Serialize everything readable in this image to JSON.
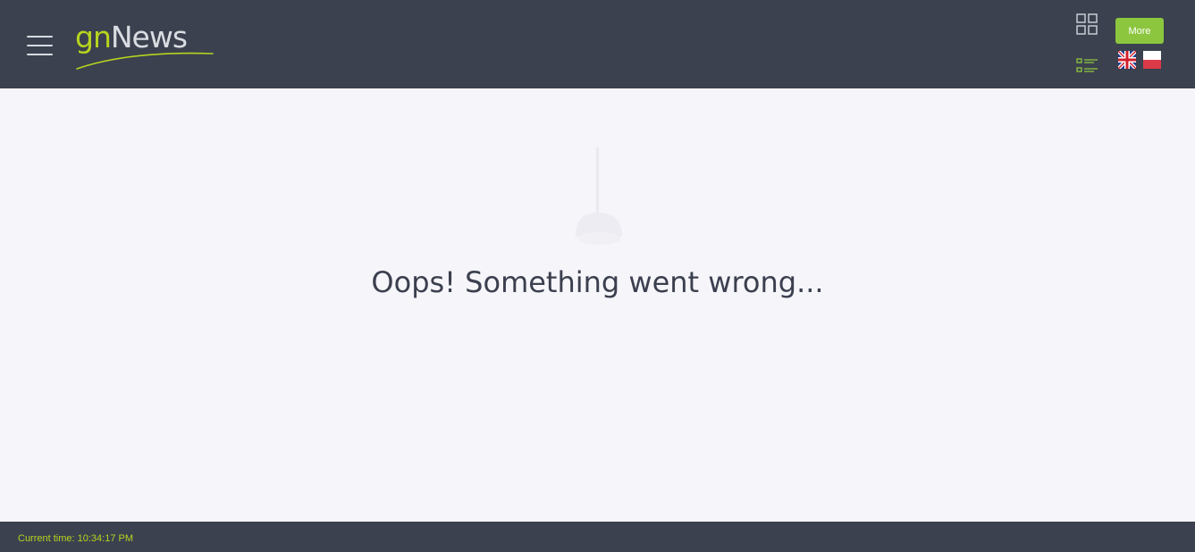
{
  "header": {
    "logo": {
      "part1": "gn",
      "part2": "News"
    },
    "more_label": "More",
    "icons": {
      "menu": "hamburger-menu-icon",
      "grid_view": "grid-view-icon",
      "list_view": "list-view-icon"
    },
    "languages": [
      "uk-flag",
      "poland-flag"
    ]
  },
  "main": {
    "error_message": "Oops! Something went wrong..."
  },
  "footer": {
    "current_time": "Current time: 10:34:17 PM"
  },
  "colors": {
    "header_bg": "#3b414f",
    "accent": "#b7d41f",
    "button": "#8cc63f",
    "page_bg": "#f5f5fa",
    "text": "#3b3f4e"
  }
}
